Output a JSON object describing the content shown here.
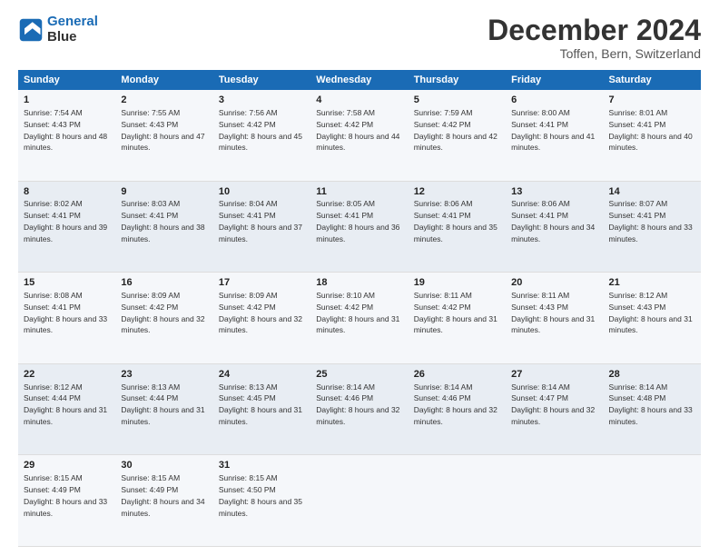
{
  "header": {
    "logo_line1": "General",
    "logo_line2": "Blue",
    "month_title": "December 2024",
    "location": "Toffen, Bern, Switzerland"
  },
  "columns": [
    "Sunday",
    "Monday",
    "Tuesday",
    "Wednesday",
    "Thursday",
    "Friday",
    "Saturday"
  ],
  "weeks": [
    [
      {
        "day": "1",
        "sunrise": "7:54 AM",
        "sunset": "4:43 PM",
        "daylight": "8 hours and 48 minutes."
      },
      {
        "day": "2",
        "sunrise": "7:55 AM",
        "sunset": "4:43 PM",
        "daylight": "8 hours and 47 minutes."
      },
      {
        "day": "3",
        "sunrise": "7:56 AM",
        "sunset": "4:42 PM",
        "daylight": "8 hours and 45 minutes."
      },
      {
        "day": "4",
        "sunrise": "7:58 AM",
        "sunset": "4:42 PM",
        "daylight": "8 hours and 44 minutes."
      },
      {
        "day": "5",
        "sunrise": "7:59 AM",
        "sunset": "4:42 PM",
        "daylight": "8 hours and 42 minutes."
      },
      {
        "day": "6",
        "sunrise": "8:00 AM",
        "sunset": "4:41 PM",
        "daylight": "8 hours and 41 minutes."
      },
      {
        "day": "7",
        "sunrise": "8:01 AM",
        "sunset": "4:41 PM",
        "daylight": "8 hours and 40 minutes."
      }
    ],
    [
      {
        "day": "8",
        "sunrise": "8:02 AM",
        "sunset": "4:41 PM",
        "daylight": "8 hours and 39 minutes."
      },
      {
        "day": "9",
        "sunrise": "8:03 AM",
        "sunset": "4:41 PM",
        "daylight": "8 hours and 38 minutes."
      },
      {
        "day": "10",
        "sunrise": "8:04 AM",
        "sunset": "4:41 PM",
        "daylight": "8 hours and 37 minutes."
      },
      {
        "day": "11",
        "sunrise": "8:05 AM",
        "sunset": "4:41 PM",
        "daylight": "8 hours and 36 minutes."
      },
      {
        "day": "12",
        "sunrise": "8:06 AM",
        "sunset": "4:41 PM",
        "daylight": "8 hours and 35 minutes."
      },
      {
        "day": "13",
        "sunrise": "8:06 AM",
        "sunset": "4:41 PM",
        "daylight": "8 hours and 34 minutes."
      },
      {
        "day": "14",
        "sunrise": "8:07 AM",
        "sunset": "4:41 PM",
        "daylight": "8 hours and 33 minutes."
      }
    ],
    [
      {
        "day": "15",
        "sunrise": "8:08 AM",
        "sunset": "4:41 PM",
        "daylight": "8 hours and 33 minutes."
      },
      {
        "day": "16",
        "sunrise": "8:09 AM",
        "sunset": "4:42 PM",
        "daylight": "8 hours and 32 minutes."
      },
      {
        "day": "17",
        "sunrise": "8:09 AM",
        "sunset": "4:42 PM",
        "daylight": "8 hours and 32 minutes."
      },
      {
        "day": "18",
        "sunrise": "8:10 AM",
        "sunset": "4:42 PM",
        "daylight": "8 hours and 31 minutes."
      },
      {
        "day": "19",
        "sunrise": "8:11 AM",
        "sunset": "4:42 PM",
        "daylight": "8 hours and 31 minutes."
      },
      {
        "day": "20",
        "sunrise": "8:11 AM",
        "sunset": "4:43 PM",
        "daylight": "8 hours and 31 minutes."
      },
      {
        "day": "21",
        "sunrise": "8:12 AM",
        "sunset": "4:43 PM",
        "daylight": "8 hours and 31 minutes."
      }
    ],
    [
      {
        "day": "22",
        "sunrise": "8:12 AM",
        "sunset": "4:44 PM",
        "daylight": "8 hours and 31 minutes."
      },
      {
        "day": "23",
        "sunrise": "8:13 AM",
        "sunset": "4:44 PM",
        "daylight": "8 hours and 31 minutes."
      },
      {
        "day": "24",
        "sunrise": "8:13 AM",
        "sunset": "4:45 PM",
        "daylight": "8 hours and 31 minutes."
      },
      {
        "day": "25",
        "sunrise": "8:14 AM",
        "sunset": "4:46 PM",
        "daylight": "8 hours and 32 minutes."
      },
      {
        "day": "26",
        "sunrise": "8:14 AM",
        "sunset": "4:46 PM",
        "daylight": "8 hours and 32 minutes."
      },
      {
        "day": "27",
        "sunrise": "8:14 AM",
        "sunset": "4:47 PM",
        "daylight": "8 hours and 32 minutes."
      },
      {
        "day": "28",
        "sunrise": "8:14 AM",
        "sunset": "4:48 PM",
        "daylight": "8 hours and 33 minutes."
      }
    ],
    [
      {
        "day": "29",
        "sunrise": "8:15 AM",
        "sunset": "4:49 PM",
        "daylight": "8 hours and 33 minutes."
      },
      {
        "day": "30",
        "sunrise": "8:15 AM",
        "sunset": "4:49 PM",
        "daylight": "8 hours and 34 minutes."
      },
      {
        "day": "31",
        "sunrise": "8:15 AM",
        "sunset": "4:50 PM",
        "daylight": "8 hours and 35 minutes."
      },
      null,
      null,
      null,
      null
    ]
  ]
}
